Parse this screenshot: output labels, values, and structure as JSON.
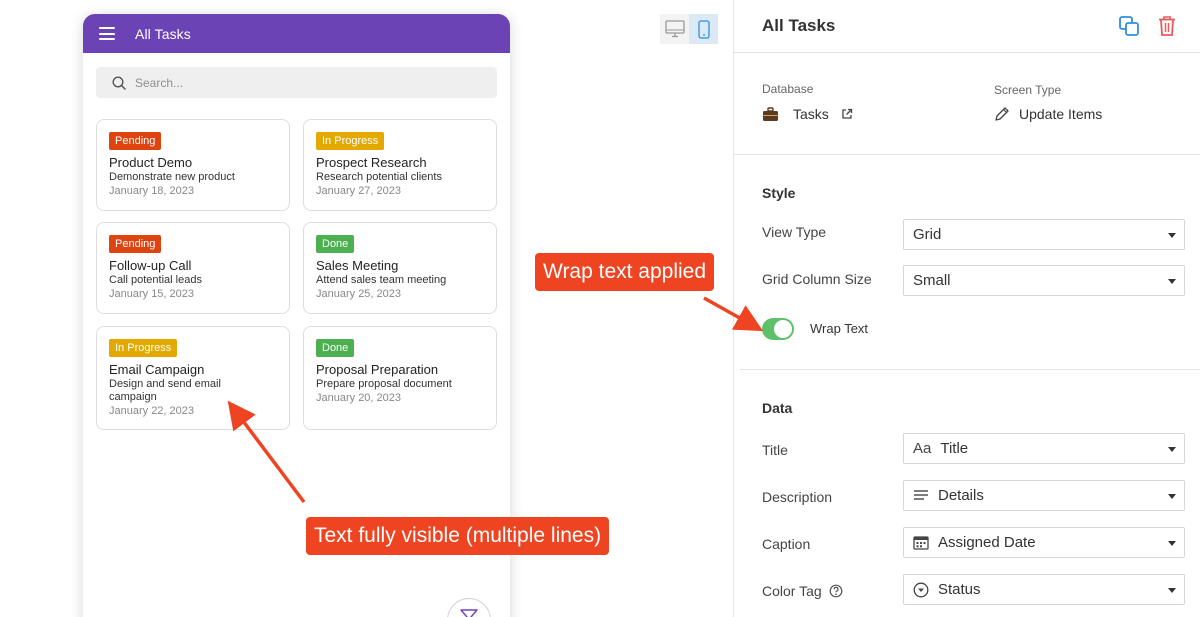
{
  "app": {
    "header_title": "All Tasks",
    "search_placeholder": "Search..."
  },
  "cards": [
    {
      "tag": "Pending",
      "tag_color": "#dd4410",
      "title": "Product Demo",
      "description": "Demonstrate new product",
      "date": "January 18, 2023"
    },
    {
      "tag": "In Progress",
      "tag_color": "#e3a900",
      "title": "Prospect Research",
      "description": "Research potential clients",
      "date": "January 27, 2023"
    },
    {
      "tag": "Pending",
      "tag_color": "#dd4410",
      "title": "Follow-up Call",
      "description": "Call potential leads",
      "date": "January 15, 2023"
    },
    {
      "tag": "Done",
      "tag_color": "#4caf50",
      "title": "Sales Meeting",
      "description": "Attend sales team meeting",
      "date": "January 25, 2023"
    },
    {
      "tag": "In Progress",
      "tag_color": "#e3a900",
      "title": "Email Campaign",
      "description": "Design and send email campaign",
      "date": "January 22, 2023"
    },
    {
      "tag": "Done",
      "tag_color": "#4caf50",
      "title": "Proposal Preparation",
      "description": "Prepare proposal document",
      "date": "January 20, 2023"
    }
  ],
  "annotations": {
    "wrap_callout": "Wrap text applied",
    "visible_callout": "Text fully visible (multiple lines)"
  },
  "panel": {
    "title": "All Tasks",
    "database_label": "Database",
    "database_value": "Tasks",
    "screen_type_label": "Screen Type",
    "screen_type_value": "Update Items",
    "style_title": "Style",
    "view_type_label": "View Type",
    "view_type_value": "Grid",
    "grid_column_label": "Grid Column Size",
    "grid_column_value": "Small",
    "wrap_text_label": "Wrap Text",
    "wrap_text_on": true,
    "data_title": "Data",
    "title_label": "Title",
    "title_value": "Title",
    "title_icon_text": "Aa",
    "description_label": "Description",
    "description_value": "Details",
    "caption_label": "Caption",
    "caption_value": "Assigned Date",
    "color_tag_label": "Color Tag",
    "color_tag_value": "Status"
  },
  "colors": {
    "header_purple": "#6b43b5",
    "accent_blue": "#2f8fe0",
    "delete_red": "#ea5a5a",
    "toggle_green": "#5ec06b",
    "callout_red": "#ee4422"
  },
  "icons": {
    "menu": "hamburger-icon",
    "search": "search-icon",
    "desktop": "desktop-icon",
    "mobile": "mobile-icon",
    "duplicate": "duplicate-icon",
    "delete": "trash-icon",
    "database": "briefcase-icon",
    "external": "external-link-icon",
    "edit": "pencil-icon",
    "details": "text-lines-icon",
    "calendar": "calendar-icon",
    "status": "chevron-circle-icon",
    "help": "help-circle-icon",
    "filter": "filter-icon"
  }
}
